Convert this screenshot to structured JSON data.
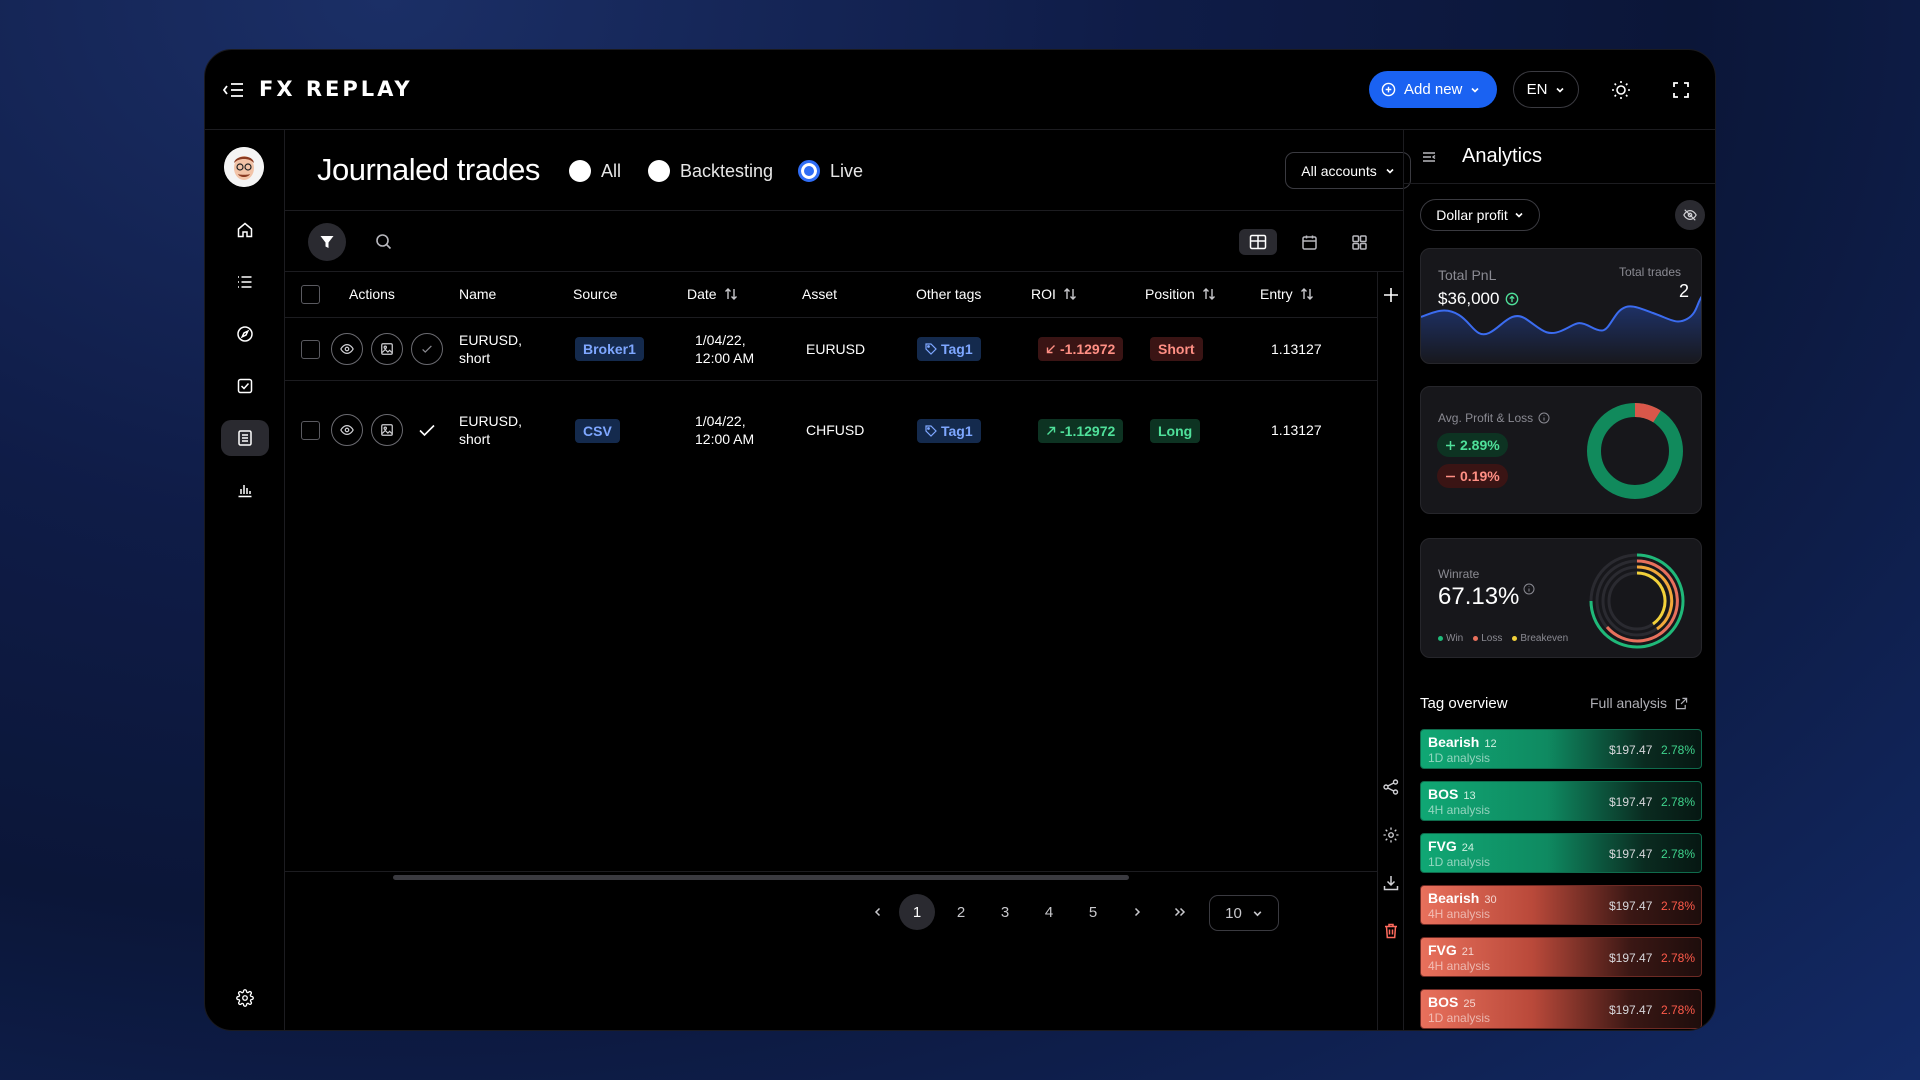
{
  "app": {
    "logo": "FX REPLAY",
    "add_new": "Add new",
    "language": "EN"
  },
  "page": {
    "title": "Journaled trades",
    "filters": [
      {
        "label": "All",
        "selected": false
      },
      {
        "label": "Backtesting",
        "selected": false
      },
      {
        "label": "Live",
        "selected": true
      }
    ],
    "accounts": "All accounts"
  },
  "table": {
    "headers": {
      "actions": "Actions",
      "name": "Name",
      "source": "Source",
      "date": "Date",
      "asset": "Asset",
      "other_tags": "Other tags",
      "roi": "ROI",
      "position": "Position",
      "entry": "Entry"
    },
    "rows": [
      {
        "name_line1": "EURUSD,",
        "name_line2": "short",
        "source": "Broker1",
        "date_line1": "1/04/22,",
        "date_line2": "12:00 AM",
        "asset": "EURUSD",
        "tag": "Tag1",
        "roi": "-1.12972",
        "roi_direction": "down",
        "position": "Short",
        "entry": "1.13127"
      },
      {
        "name_line1": "EURUSD,",
        "name_line2": "short",
        "source": "CSV",
        "date_line1": "1/04/22,",
        "date_line2": "12:00 AM",
        "asset": "CHFUSD",
        "tag": "Tag1",
        "roi": "-1.12972",
        "roi_direction": "up",
        "position": "Long",
        "entry": "1.13127"
      }
    ]
  },
  "pagination": {
    "pages": [
      "1",
      "2",
      "3",
      "4",
      "5"
    ],
    "current": "1",
    "per_page": "10"
  },
  "analytics": {
    "title": "Analytics",
    "metric": "Dollar profit",
    "total_pnl_label": "Total PnL",
    "total_pnl": "$36,000",
    "total_trades_label": "Total trades",
    "total_trades": "2",
    "avg_pl_label": "Avg. Profit & Loss",
    "avg_profit": "2.89%",
    "avg_loss": "0.19%",
    "winrate_label": "Winrate",
    "winrate": "67.13%",
    "legend": [
      "Win",
      "Loss",
      "Breakeven"
    ],
    "tag_overview": "Tag overview",
    "full_analysis": "Full analysis",
    "tags": [
      {
        "name": "Bearish",
        "count": "12",
        "sub": "1D analysis",
        "amount": "$197.47",
        "pct": "2.78%",
        "tone": "green"
      },
      {
        "name": "BOS",
        "count": "13",
        "sub": "4H analysis",
        "amount": "$197.47",
        "pct": "2.78%",
        "tone": "green"
      },
      {
        "name": "FVG",
        "count": "24",
        "sub": "1D analysis",
        "amount": "$197.47",
        "pct": "2.78%",
        "tone": "green"
      },
      {
        "name": "Bearish",
        "count": "30",
        "sub": "4H analysis",
        "amount": "$197.47",
        "pct": "2.78%",
        "tone": "red"
      },
      {
        "name": "FVG",
        "count": "21",
        "sub": "4H analysis",
        "amount": "$197.47",
        "pct": "2.78%",
        "tone": "red"
      },
      {
        "name": "BOS",
        "count": "25",
        "sub": "1D analysis",
        "amount": "$197.47",
        "pct": "2.78%",
        "tone": "red"
      }
    ]
  },
  "colors": {
    "accent": "#1a62f2",
    "profit": "#4fe09a",
    "loss": "#ff8f84"
  }
}
